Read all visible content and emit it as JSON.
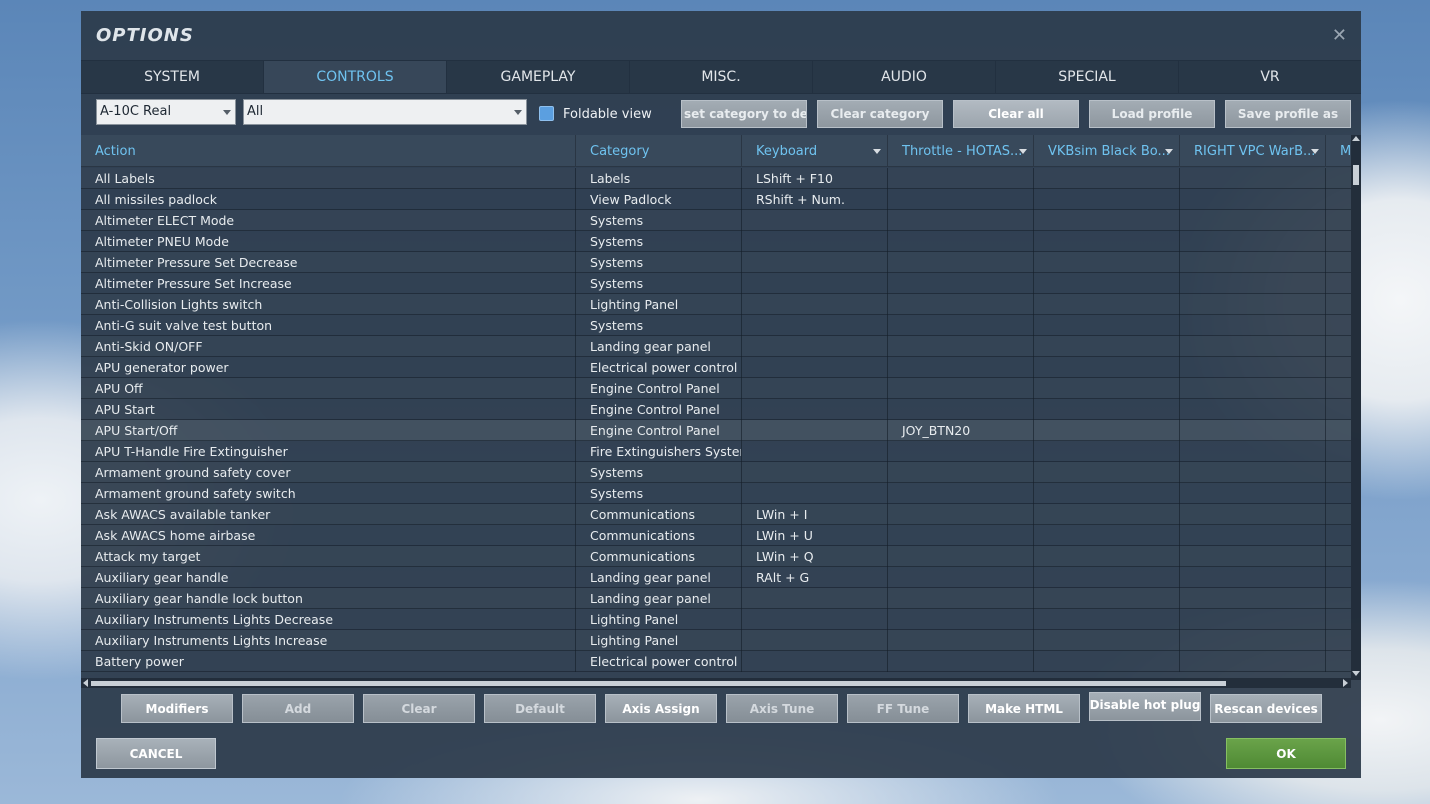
{
  "dialog": {
    "title": "OPTIONS"
  },
  "tabs": [
    {
      "label": "SYSTEM"
    },
    {
      "label": "CONTROLS"
    },
    {
      "label": "GAMEPLAY"
    },
    {
      "label": "MISC."
    },
    {
      "label": "AUDIO"
    },
    {
      "label": "SPECIAL"
    },
    {
      "label": "VR"
    }
  ],
  "active_tab": "CONTROLS",
  "toolbar": {
    "aircraft_select": "A-10C Real",
    "category_select": "All",
    "foldable_view_label": "Foldable view",
    "foldable_view_checked": true,
    "reset_category_label": "set category to defa",
    "clear_category_label": "Clear category",
    "clear_all_label": "Clear all",
    "load_profile_label": "Load profile",
    "save_profile_label": "Save profile as"
  },
  "grid": {
    "columns": [
      "Action",
      "Category",
      "Keyboard",
      "Throttle - HOTAS...",
      "VKBsim Black Bo...",
      "RIGHT VPC WarB...",
      "M"
    ],
    "rows": [
      {
        "action": "All Labels",
        "category": "Labels",
        "keyboard": "LShift + F10",
        "throttle": ""
      },
      {
        "action": "All missiles padlock",
        "category": "View Padlock",
        "keyboard": "RShift + Num.",
        "throttle": ""
      },
      {
        "action": "Altimeter ELECT Mode",
        "category": "Systems",
        "keyboard": "",
        "throttle": ""
      },
      {
        "action": "Altimeter PNEU Mode",
        "category": "Systems",
        "keyboard": "",
        "throttle": ""
      },
      {
        "action": "Altimeter Pressure Set Decrease",
        "category": "Systems",
        "keyboard": "",
        "throttle": ""
      },
      {
        "action": "Altimeter Pressure Set Increase",
        "category": "Systems",
        "keyboard": "",
        "throttle": ""
      },
      {
        "action": "Anti-Collision Lights switch",
        "category": "Lighting Panel",
        "keyboard": "",
        "throttle": ""
      },
      {
        "action": "Anti-G suit valve test button",
        "category": "Systems",
        "keyboard": "",
        "throttle": ""
      },
      {
        "action": "Anti-Skid ON/OFF",
        "category": "Landing gear panel",
        "keyboard": "",
        "throttle": ""
      },
      {
        "action": "APU generator power",
        "category": "Electrical power control pa",
        "keyboard": "",
        "throttle": ""
      },
      {
        "action": "APU Off",
        "category": "Engine Control Panel",
        "keyboard": "",
        "throttle": ""
      },
      {
        "action": "APU Start",
        "category": "Engine Control Panel",
        "keyboard": "",
        "throttle": ""
      },
      {
        "action": "APU Start/Off",
        "category": "Engine Control Panel",
        "keyboard": "",
        "throttle": "JOY_BTN20"
      },
      {
        "action": "APU T-Handle Fire Extinguisher",
        "category": "Fire Extinguishers System",
        "keyboard": "",
        "throttle": ""
      },
      {
        "action": "Armament ground safety cover",
        "category": "Systems",
        "keyboard": "",
        "throttle": ""
      },
      {
        "action": "Armament ground safety switch",
        "category": "Systems",
        "keyboard": "",
        "throttle": ""
      },
      {
        "action": "Ask AWACS available tanker",
        "category": "Communications",
        "keyboard": "LWin + I",
        "throttle": ""
      },
      {
        "action": "Ask AWACS home airbase",
        "category": "Communications",
        "keyboard": "LWin + U",
        "throttle": ""
      },
      {
        "action": "Attack my target",
        "category": "Communications",
        "keyboard": "LWin + Q",
        "throttle": ""
      },
      {
        "action": "Auxiliary gear handle",
        "category": "Landing gear panel",
        "keyboard": "RAlt + G",
        "throttle": ""
      },
      {
        "action": "Auxiliary gear handle lock button",
        "category": "Landing gear panel",
        "keyboard": "",
        "throttle": ""
      },
      {
        "action": "Auxiliary Instruments Lights Decrease",
        "category": "Lighting Panel",
        "keyboard": "",
        "throttle": ""
      },
      {
        "action": "Auxiliary Instruments Lights Increase",
        "category": "Lighting Panel",
        "keyboard": "",
        "throttle": ""
      },
      {
        "action": "Battery power",
        "category": "Electrical power control pa",
        "keyboard": "",
        "throttle": ""
      }
    ],
    "selected_row": "APU Start/Off"
  },
  "bottom_buttons": [
    {
      "label": "Modifiers",
      "enabled": true
    },
    {
      "label": "Add",
      "enabled": false
    },
    {
      "label": "Clear",
      "enabled": false
    },
    {
      "label": "Default",
      "enabled": false
    },
    {
      "label": "Axis Assign",
      "enabled": true
    },
    {
      "label": "Axis Tune",
      "enabled": false
    },
    {
      "label": "FF Tune",
      "enabled": false
    },
    {
      "label": "Make HTML",
      "enabled": true
    },
    {
      "label": "Disable hot plug",
      "enabled": true
    },
    {
      "label": "Rescan devices",
      "enabled": true
    }
  ],
  "footer": {
    "cancel_label": "CANCEL",
    "ok_label": "OK"
  },
  "colors": {
    "accent": "#6fc3f0",
    "ok": "#5a9a3e",
    "checkbox": "#5b9fe0"
  }
}
